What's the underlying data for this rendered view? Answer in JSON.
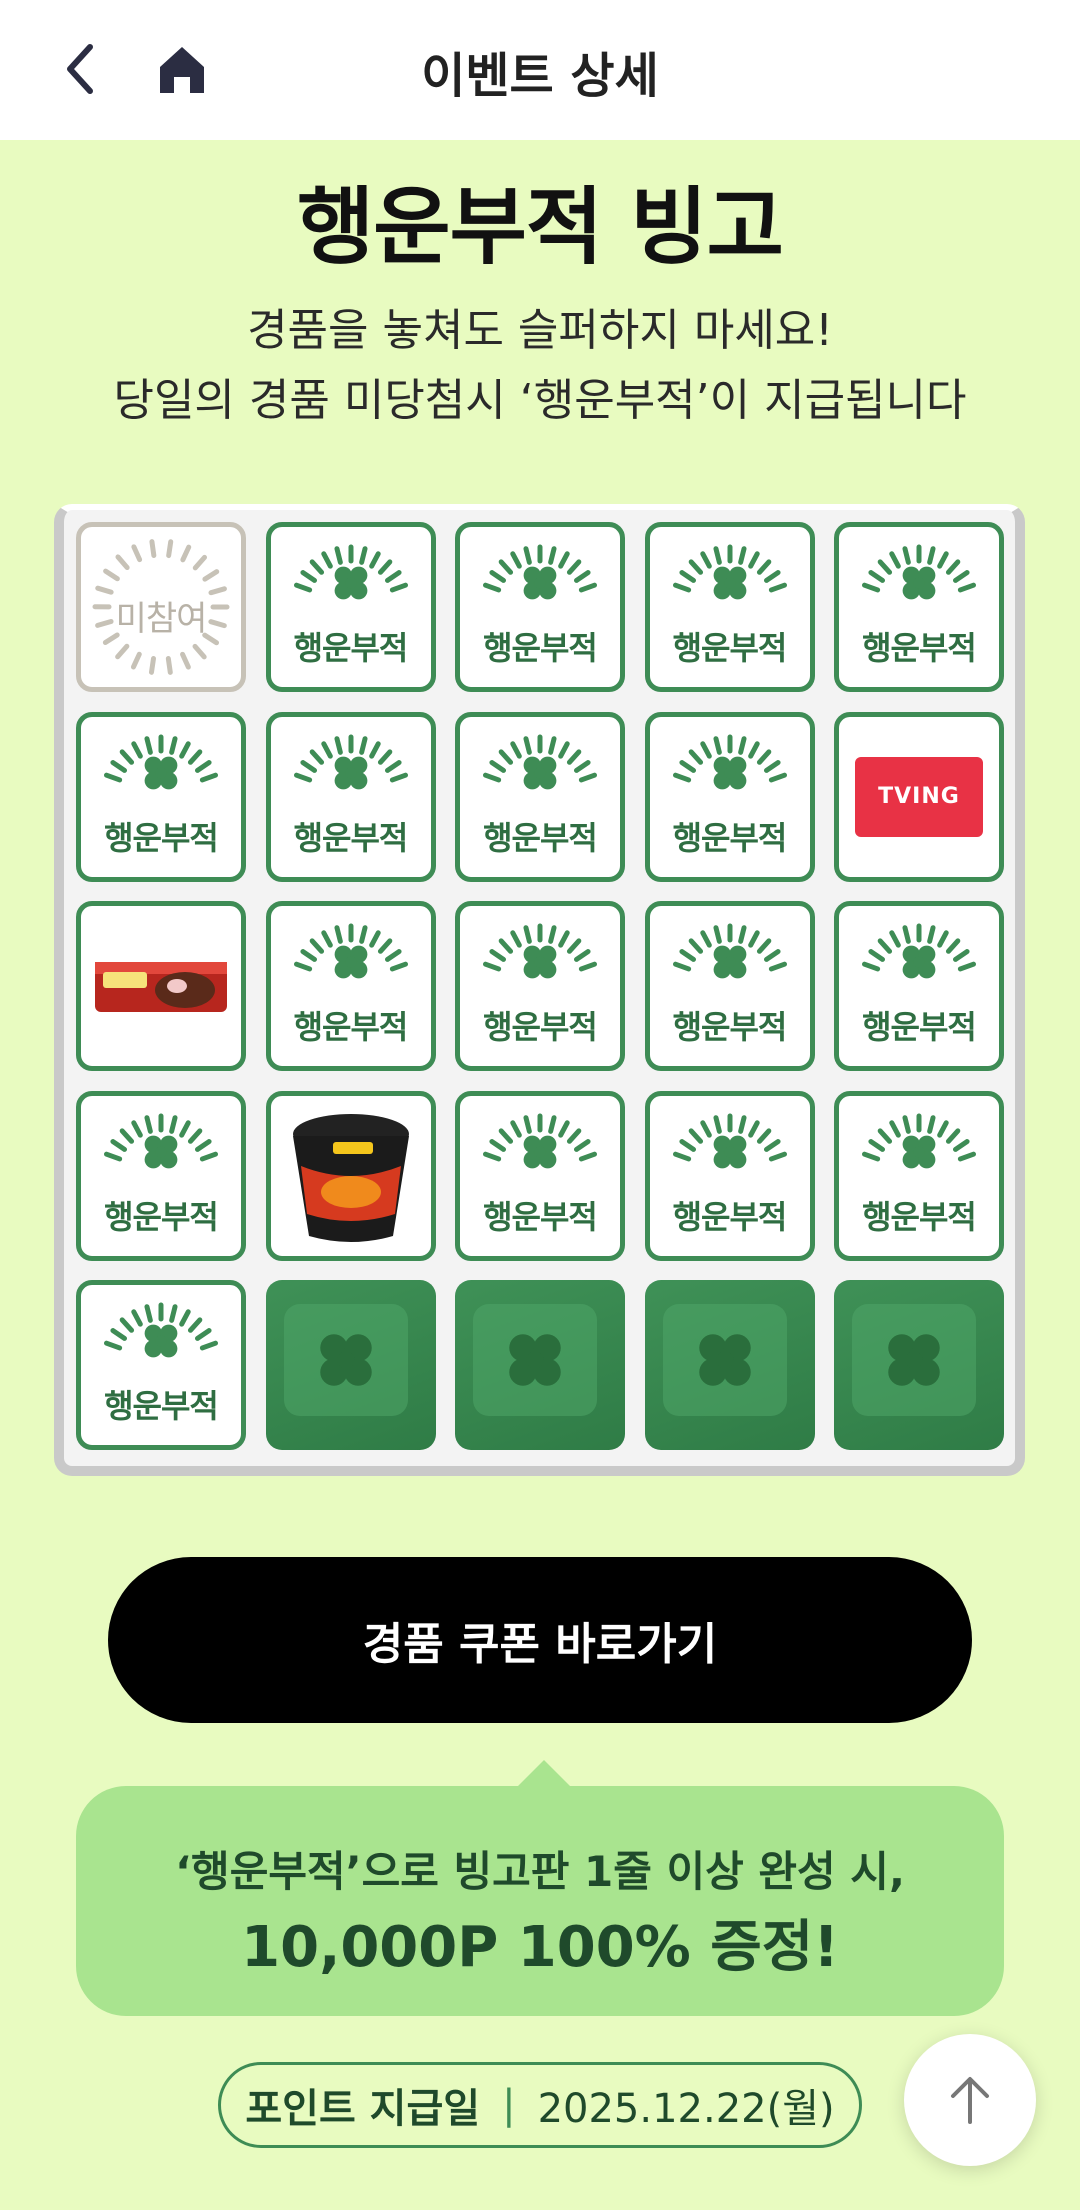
{
  "header": {
    "title": "이벤트 상세"
  },
  "hero": {
    "title": "행운부적 빙고",
    "subtitle_1": "경품을 놓쳐도 슬퍼하지 마세요!",
    "subtitle_2": "당일의 경품 미당첨시 ‘행운부적’이 지급됩니다"
  },
  "bingo": {
    "lucky_label": "행운부적",
    "none_label": "미참여",
    "cells": [
      [
        "none",
        "lucky",
        "lucky",
        "lucky",
        "lucky"
      ],
      [
        "lucky",
        "lucky",
        "lucky",
        "lucky",
        "prize-tving"
      ],
      [
        "prize-snack",
        "lucky",
        "lucky",
        "lucky",
        "lucky"
      ],
      [
        "lucky",
        "prize-ramen",
        "lucky",
        "lucky",
        "lucky"
      ],
      [
        "lucky",
        "empty",
        "empty",
        "empty",
        "empty"
      ]
    ],
    "prizes": {
      "tving_logo": "TVING"
    }
  },
  "cta": {
    "label": "경품 쿠폰 바로가기"
  },
  "promo": {
    "line_1": "‘행운부적’으로 빙고판 1줄 이상 완성 시,",
    "line_2": "10,000P 100% 증정!"
  },
  "payment": {
    "label": "포인트 지급일",
    "separator": "|",
    "date": "2025.12.22(월)"
  },
  "colors": {
    "background": "#e8fbc0",
    "accent_green": "#3e8c55",
    "promo_bg": "#a9e48f"
  }
}
